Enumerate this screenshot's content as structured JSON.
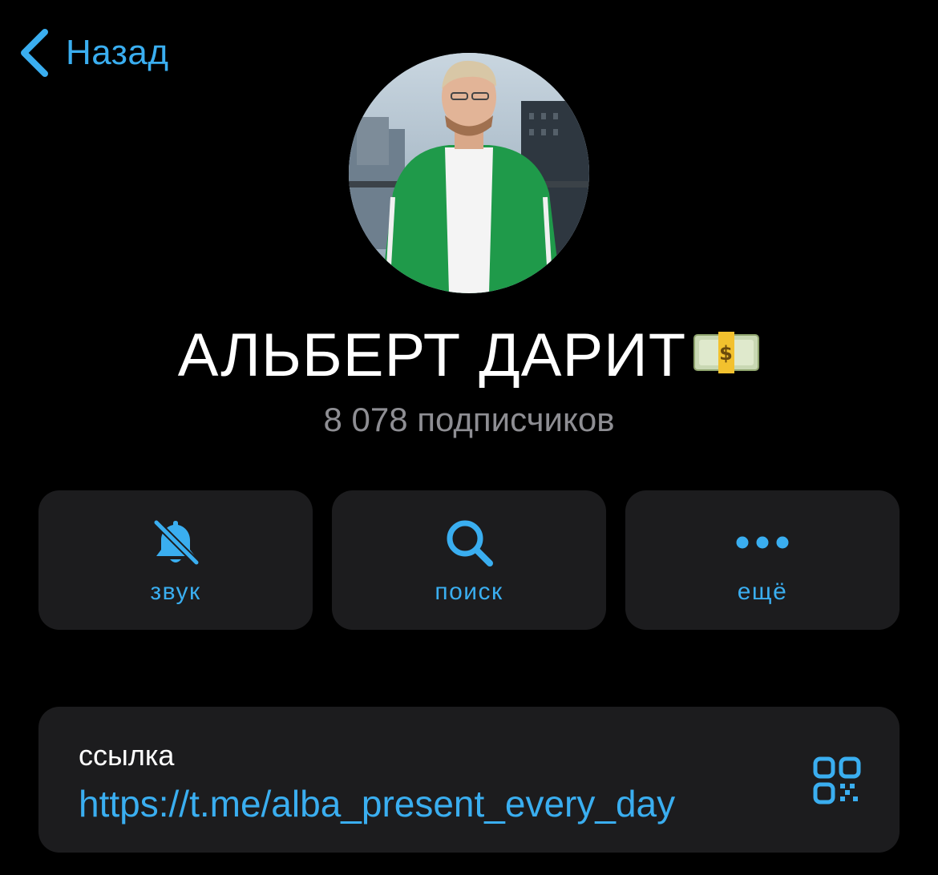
{
  "header": {
    "back_label": "Назад",
    "back_icon": "chevron-left-icon"
  },
  "colors": {
    "background": "#000000",
    "card": "#1c1c1e",
    "accent": "#3aaef0",
    "secondary_text": "#8e8e93",
    "primary_text": "#ffffff"
  },
  "profile": {
    "name": "АЛЬБЕРТ ДАРИТ",
    "name_emoji": "money-bag-banknote-icon",
    "subscribers": "8 078 подписчиков"
  },
  "actions": [
    {
      "label": "звук",
      "icon": "bell-slash-icon"
    },
    {
      "label": "поиск",
      "icon": "search-icon"
    },
    {
      "label": "ещё",
      "icon": "more-dots-icon"
    }
  ],
  "link": {
    "title": "ссылка",
    "url": "https://t.me/alba_present_every_day",
    "qr_icon": "qr-code-icon"
  }
}
